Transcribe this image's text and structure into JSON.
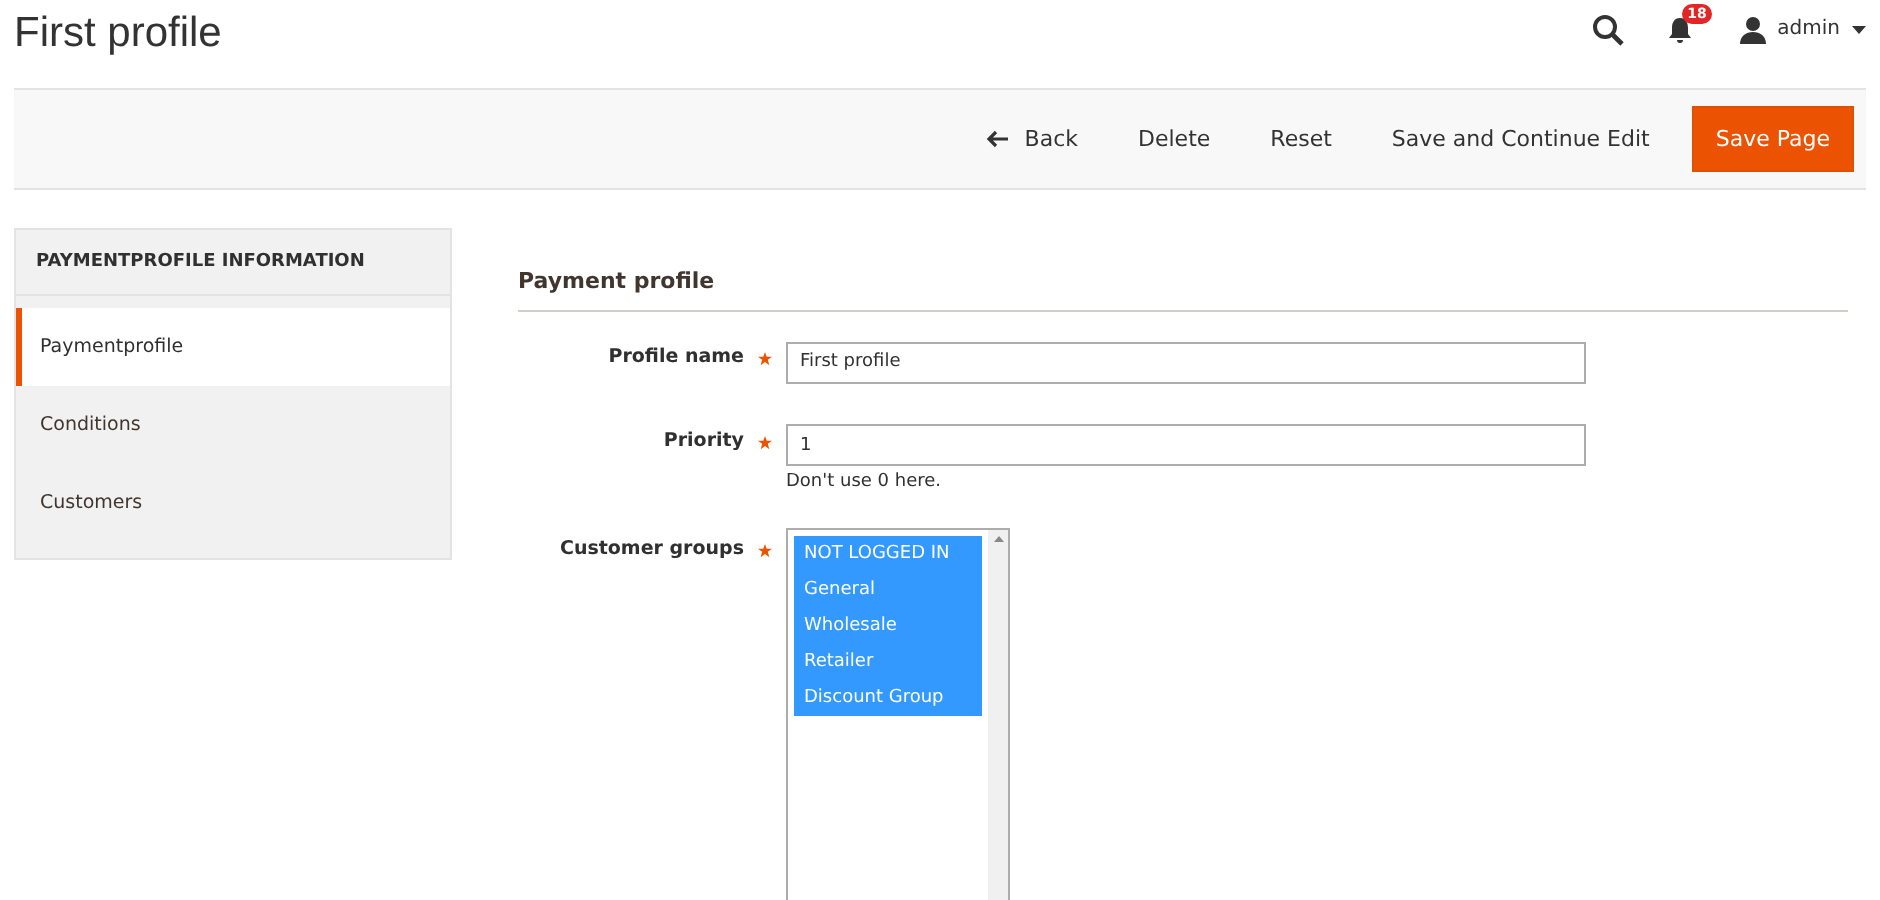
{
  "page_title": "First profile",
  "header": {
    "notifications_count": "18",
    "user": "admin"
  },
  "actions": [
    {
      "label": "Back",
      "kind": "back"
    },
    {
      "label": "Delete",
      "kind": "plain"
    },
    {
      "label": "Reset",
      "kind": "plain"
    },
    {
      "label": "Save and Continue Edit",
      "kind": "plain"
    },
    {
      "label": "Save Page",
      "kind": "primary"
    }
  ],
  "sidebar": {
    "title": "PAYMENTPROFILE INFORMATION",
    "items": [
      {
        "label": "Paymentprofile",
        "selected": true
      },
      {
        "label": "Conditions",
        "selected": false
      },
      {
        "label": "Customers",
        "selected": false
      }
    ]
  },
  "section_title": "Payment profile",
  "fields": [
    {
      "label": "Profile name",
      "required": true,
      "kind": "text",
      "value": "First profile"
    },
    {
      "label": "Priority",
      "required": true,
      "kind": "text",
      "value": "1",
      "note": "Don't use 0 here."
    },
    {
      "label": "Customer groups",
      "required": true,
      "kind": "multiselect",
      "options": [
        {
          "label": "NOT LOGGED IN",
          "selected": true
        },
        {
          "label": "General",
          "selected": true
        },
        {
          "label": "Wholesale",
          "selected": true
        },
        {
          "label": "Retailer",
          "selected": true
        },
        {
          "label": "Discount Group",
          "selected": true
        }
      ]
    }
  ]
}
